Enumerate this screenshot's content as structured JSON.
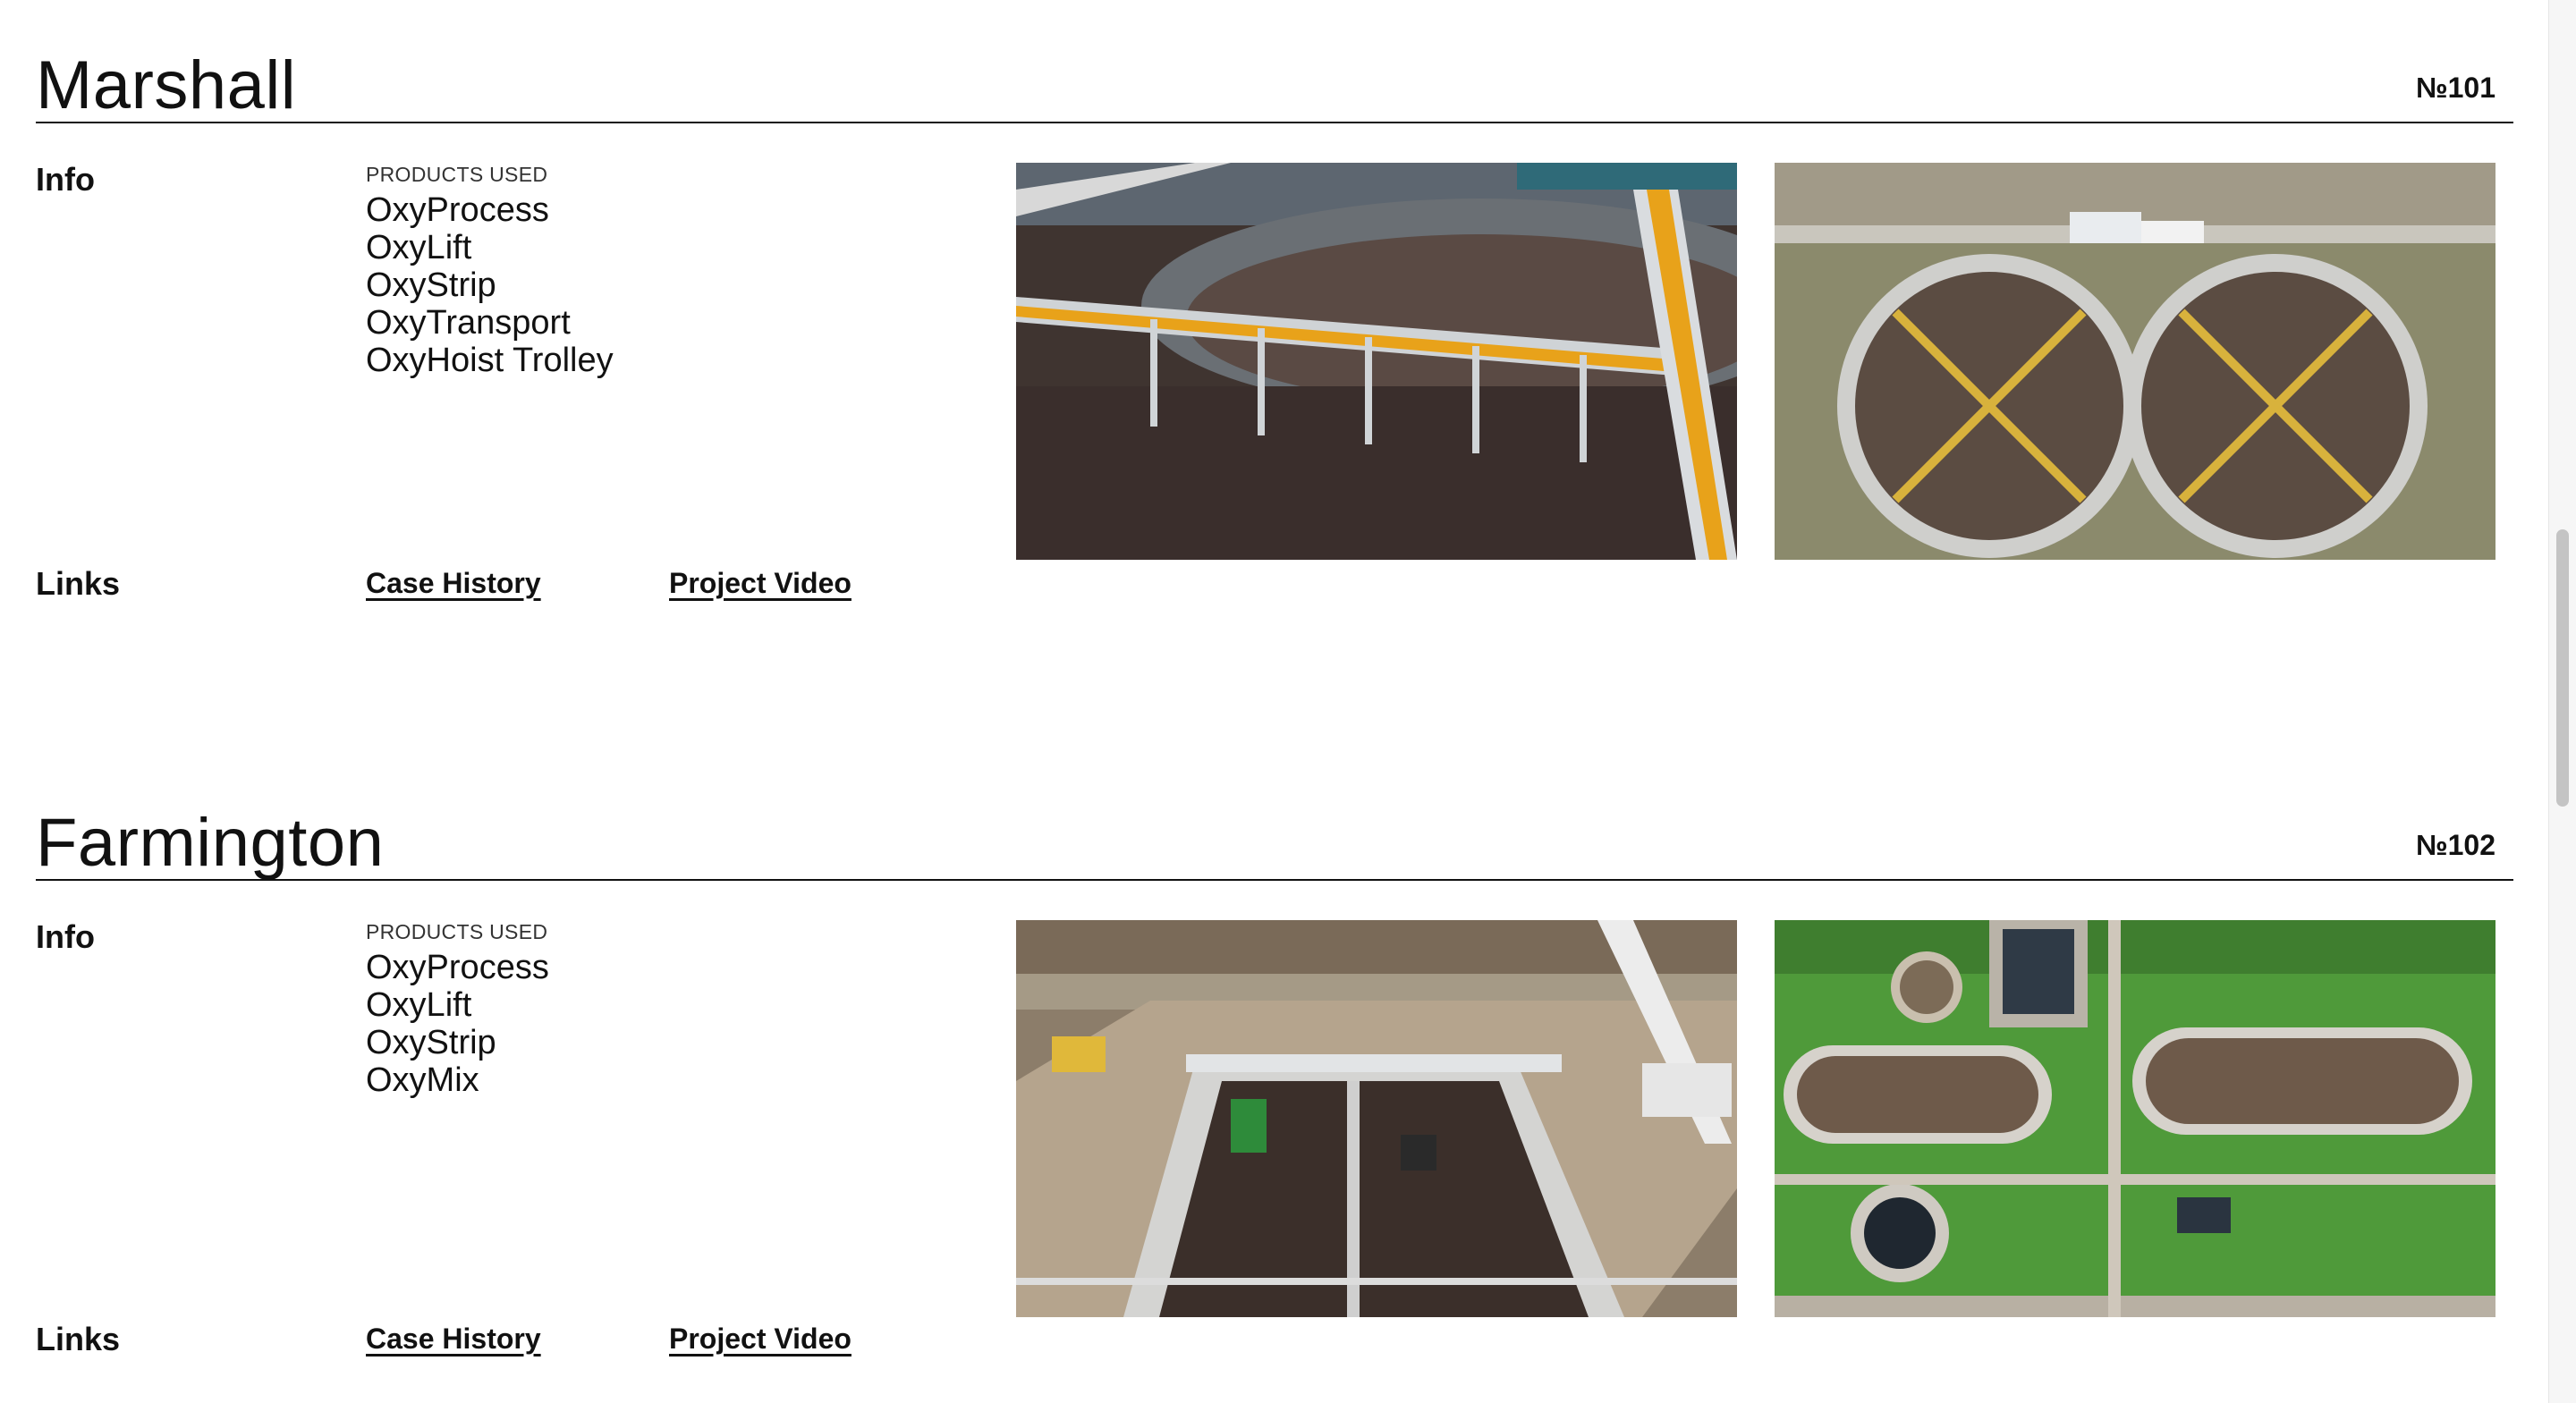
{
  "projects": [
    {
      "title": "Marshall",
      "number": "№101",
      "info_label": "Info",
      "products_heading": "PRODUCTS USED",
      "products": [
        "OxyProcess",
        "OxyLift",
        "OxyStrip",
        "OxyTransport",
        "OxyHoist Trolley"
      ],
      "links_label": "Links",
      "links": [
        "Case History",
        "Project Video"
      ],
      "photos": [
        "walkway-over-basin-photo",
        "aerial-clarifiers-photo"
      ]
    },
    {
      "title": "Farmington",
      "number": "№102",
      "info_label": "Info",
      "products_heading": "PRODUCTS USED",
      "products": [
        "OxyProcess",
        "OxyLift",
        "OxyStrip",
        "OxyMix"
      ],
      "links_label": "Links",
      "links": [
        "Case History",
        "Project Video"
      ],
      "photos": [
        "construction-site-photo",
        "aerial-treatment-plant-photo"
      ]
    }
  ],
  "colors": {
    "text": "#111111",
    "accent_walkway": "#e8a21a",
    "grass": "#4f9a3a",
    "water": "#4a3a34"
  }
}
